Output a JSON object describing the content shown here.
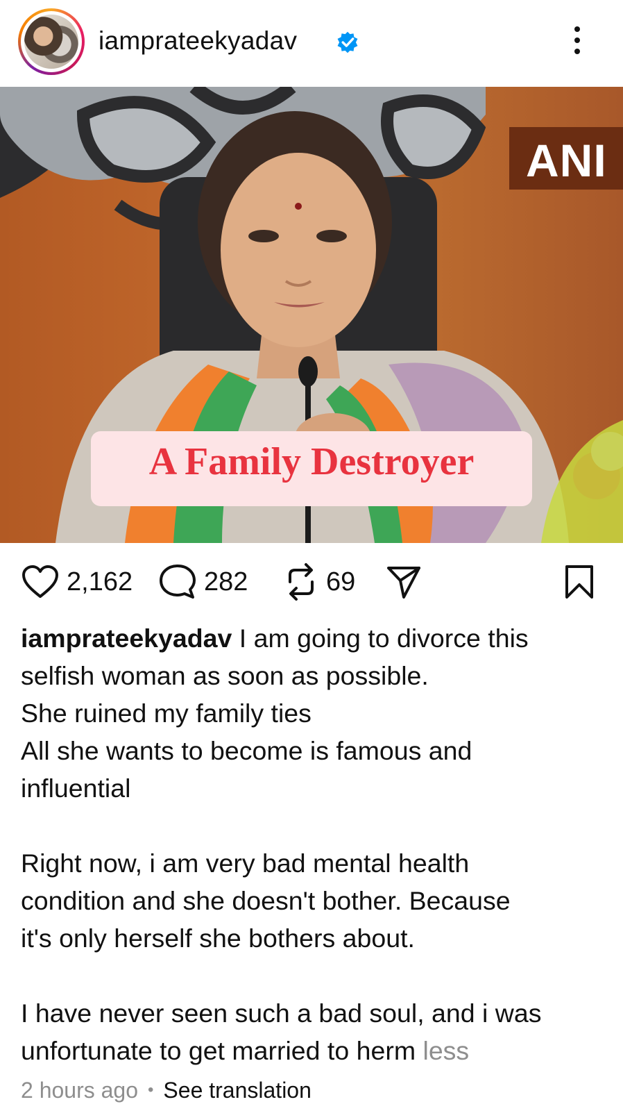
{
  "header": {
    "username": "iamprateekyadav",
    "verified_color": "#0095f6"
  },
  "post_image": {
    "channel_badge": "ANI",
    "overlay_caption": "A Family Destroyer",
    "overlay_caption_color": "#e8333f"
  },
  "actions": {
    "likes": "2,162",
    "comments": "282",
    "reposts": "69"
  },
  "caption": {
    "username": "iamprateekyadav",
    "lines": [
      "I am going to divorce this",
      "selfish woman as soon as possible.",
      "She ruined my family ties",
      "All she wants to become is famous and",
      "influential",
      "",
      "Right now, i am very bad mental health",
      "condition and she doesn't bother. Because",
      "it's only herself she bothers about.",
      "",
      "I have never seen such a bad soul, and i was",
      "unfortunate to get married to herm"
    ],
    "less_label": "less"
  },
  "meta": {
    "time": "2 hours ago",
    "separator": "•",
    "see_translation": "See translation"
  }
}
